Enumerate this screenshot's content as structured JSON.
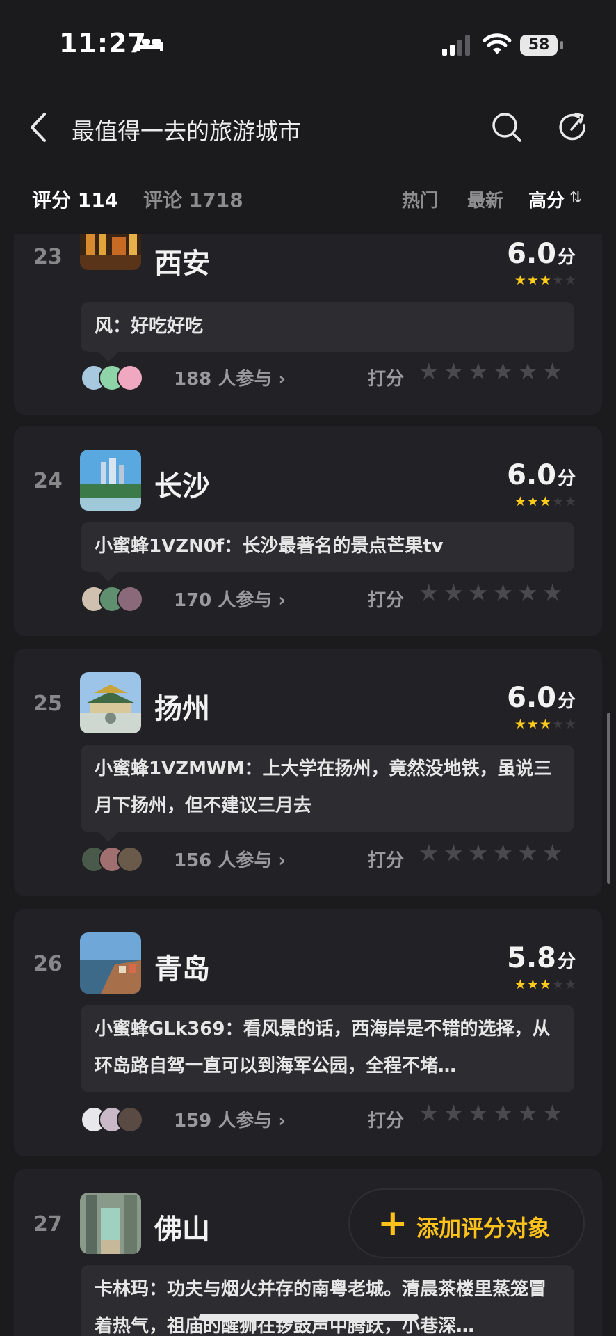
{
  "status_bar": {
    "time": "11:27",
    "battery": "58"
  },
  "header": {
    "title": "最值得一去的旅游城市"
  },
  "tabs": {
    "rating": "评分 114",
    "comments": "评论 1718",
    "hot": "热门",
    "newest": "最新",
    "high": "高分"
  },
  "items": [
    {
      "rank": "23",
      "city": "西安",
      "score": "6.0",
      "unit": "分",
      "stars_filled": 3,
      "comment": "风：好吃好吃",
      "participants": "188 人参与 ›",
      "rate_label": "打分"
    },
    {
      "rank": "24",
      "city": "长沙",
      "score": "6.0",
      "unit": "分",
      "stars_filled": 3,
      "comment": "小蜜蜂1VZN0f：长沙最著名的景点芒果tv",
      "participants": "170 人参与 ›",
      "rate_label": "打分"
    },
    {
      "rank": "25",
      "city": "扬州",
      "score": "6.0",
      "unit": "分",
      "stars_filled": 3,
      "comment": "小蜜蜂1VZMWM：上大学在扬州，竟然没地铁，虽说三月下扬州，但不建议三月去",
      "participants": "156 人参与 ›",
      "rate_label": "打分"
    },
    {
      "rank": "26",
      "city": "青岛",
      "score": "5.8",
      "unit": "分",
      "stars_filled": 3,
      "comment": "小蜜蜂GLk369：看风景的话，西海岸是不错的选择，从环岛路自驾一直可以到海军公园，全程不堵…",
      "participants": "159 人参与 ›",
      "rate_label": "打分"
    },
    {
      "rank": "27",
      "city": "佛山",
      "score": "",
      "unit": "",
      "stars_filled": 0,
      "comment": "卡林玛：功夫与烟火并存的南粤老城。清晨茶楼里蒸笼冒着热气，祖庙的醒狮在锣鼓声中腾跃，小巷深…",
      "participants": "",
      "rate_label": ""
    }
  ],
  "fab": {
    "label": "添加评分对象"
  },
  "colors": {
    "accent": "#ffc21a",
    "star": "#ffcc1a",
    "background": "#1b1b1e",
    "card": "#222226"
  }
}
